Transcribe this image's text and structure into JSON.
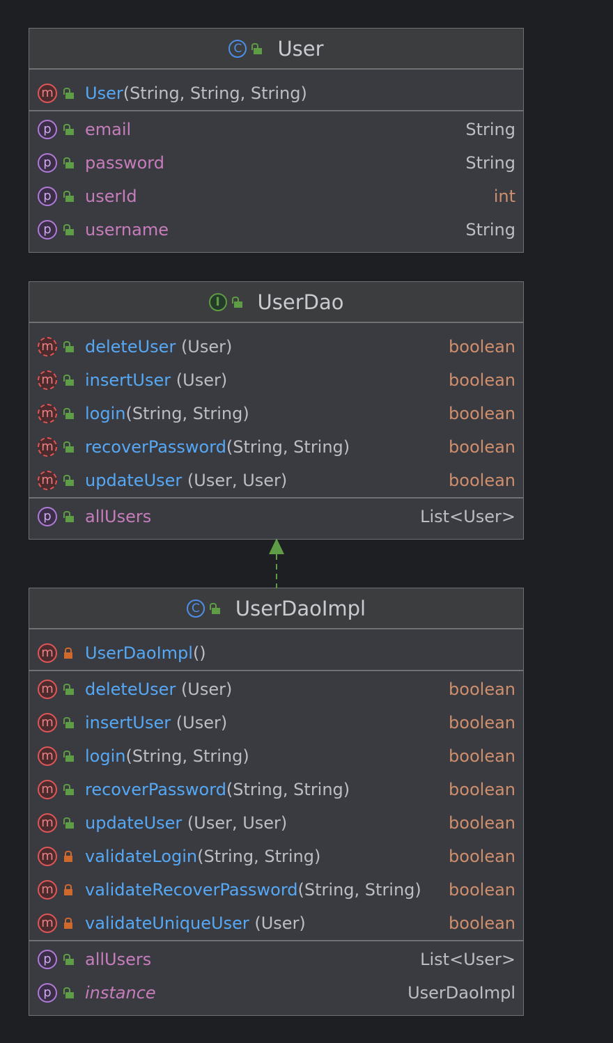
{
  "colors": {
    "background": "#1e1f22",
    "method_name": "#56a8f5",
    "property_name": "#c77dbb",
    "primitive_type": "#cf8e6d",
    "text": "#bcbec4",
    "public_lock": "#5e9c45",
    "private_lock": "#d0692e",
    "class_icon": "#4d8ee8",
    "interface_icon": "#5e9c45",
    "relation": "#5e9c45"
  },
  "classes": [
    {
      "name": "User",
      "kind": "class",
      "kind_glyph": "C",
      "sections": [
        [
          {
            "type": "method",
            "visibility": "public",
            "name": "User",
            "params": "(String, String, String)",
            "return": ""
          }
        ],
        [
          {
            "type": "property",
            "visibility": "public",
            "name": "email",
            "return": "String"
          },
          {
            "type": "property",
            "visibility": "public",
            "name": "password",
            "return": "String"
          },
          {
            "type": "property",
            "visibility": "public",
            "name": "userId",
            "return": "int",
            "return_style": "orange"
          },
          {
            "type": "property",
            "visibility": "public",
            "name": "username",
            "return": "String"
          }
        ]
      ]
    },
    {
      "name": "UserDao",
      "kind": "interface",
      "kind_glyph": "I",
      "sections": [
        [
          {
            "type": "method",
            "abstract": true,
            "visibility": "public",
            "name": "deleteUser",
            "params": " (User)",
            "return": "boolean"
          },
          {
            "type": "method",
            "abstract": true,
            "visibility": "public",
            "name": "insertUser",
            "params": " (User)",
            "return": "boolean"
          },
          {
            "type": "method",
            "abstract": true,
            "visibility": "public",
            "name": "login",
            "params": "(String, String)",
            "return": "boolean"
          },
          {
            "type": "method",
            "abstract": true,
            "visibility": "public",
            "name": "recoverPassword",
            "params": "(String, String)",
            "return": "boolean"
          },
          {
            "type": "method",
            "abstract": true,
            "visibility": "public",
            "name": "updateUser",
            "params": " (User, User)",
            "return": "boolean"
          }
        ],
        [
          {
            "type": "property",
            "visibility": "public",
            "name": "allUsers",
            "return": "List<User>"
          }
        ]
      ]
    },
    {
      "name": "UserDaoImpl",
      "kind": "class",
      "kind_glyph": "C",
      "sections": [
        [
          {
            "type": "method",
            "visibility": "private",
            "name": "UserDaoImpl",
            "params": "()",
            "return": ""
          }
        ],
        [
          {
            "type": "method",
            "visibility": "public",
            "name": "deleteUser",
            "params": " (User)",
            "return": "boolean"
          },
          {
            "type": "method",
            "visibility": "public",
            "name": "insertUser",
            "params": " (User)",
            "return": "boolean"
          },
          {
            "type": "method",
            "visibility": "public",
            "name": "login",
            "params": "(String, String)",
            "return": "boolean"
          },
          {
            "type": "method",
            "visibility": "public",
            "name": "recoverPassword",
            "params": "(String, String)",
            "return": "boolean"
          },
          {
            "type": "method",
            "visibility": "public",
            "name": "updateUser",
            "params": " (User, User)",
            "return": "boolean"
          },
          {
            "type": "method",
            "visibility": "private",
            "name": "validateLogin",
            "params": "(String, String)",
            "return": "boolean"
          },
          {
            "type": "method",
            "visibility": "private",
            "name": "validateRecoverPassword",
            "params": "(String, String)",
            "return": "boolean"
          },
          {
            "type": "method",
            "visibility": "private",
            "name": "validateUniqueUser",
            "params": " (User)",
            "return": "boolean"
          }
        ],
        [
          {
            "type": "property",
            "visibility": "public",
            "name": "allUsers",
            "return": "List<User>"
          },
          {
            "type": "property",
            "visibility": "public",
            "static": true,
            "name": "instance",
            "return": "UserDaoImpl"
          }
        ]
      ]
    }
  ],
  "relations": [
    {
      "from": "UserDaoImpl",
      "to": "UserDao",
      "type": "implements"
    }
  ]
}
